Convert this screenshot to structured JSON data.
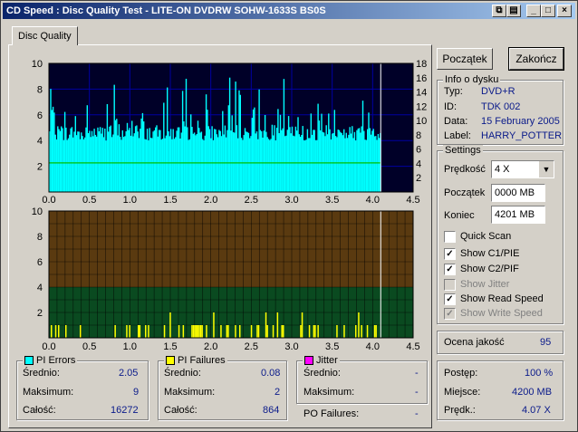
{
  "window": {
    "title": "CD Speed : Disc Quality Test - LITE-ON DVDRW SOHW-1633S BS0S",
    "min_glyph": "_",
    "max_glyph": "□",
    "close_glyph": "×"
  },
  "tabs": [
    {
      "label": "Disc Quality"
    }
  ],
  "buttons": {
    "start": "Początek",
    "end": "Zakończ"
  },
  "disc_info": {
    "title": "Info o dysku",
    "rows": [
      {
        "label": "Typ:",
        "value": "DVD+R"
      },
      {
        "label": "ID:",
        "value": "TDK 002"
      },
      {
        "label": "Data:",
        "value": "15 February 2005"
      },
      {
        "label": "Label:",
        "value": "HARRY_POTTER"
      }
    ]
  },
  "settings": {
    "title": "Settings",
    "speed_label": "Prędkość",
    "speed_value": "4 X",
    "start_label": "Początek",
    "start_value": "0000 MB",
    "end_label": "Koniec",
    "end_value": "4201 MB",
    "checkboxes": [
      {
        "label": "Quick Scan",
        "checked": false,
        "enabled": true
      },
      {
        "label": "Show C1/PIE",
        "checked": true,
        "enabled": true
      },
      {
        "label": "Show C2/PIF",
        "checked": true,
        "enabled": true
      },
      {
        "label": "Show Jitter",
        "checked": false,
        "enabled": false
      },
      {
        "label": "Show Read Speed",
        "checked": true,
        "enabled": true
      },
      {
        "label": "Show Write Speed",
        "checked": true,
        "enabled": false
      }
    ]
  },
  "quality": {
    "label": "Ocena jakość",
    "value": "95"
  },
  "progress": {
    "rows": [
      {
        "label": "Postęp:",
        "value": "100 %"
      },
      {
        "label": "Miejsce:",
        "value": "4200 MB"
      },
      {
        "label": "Prędk.:",
        "value": "4.07 X"
      }
    ]
  },
  "stats": {
    "pi_errors": {
      "title": "PI Errors",
      "color": "#00ffff",
      "rows": [
        {
          "label": "Średnio:",
          "value": "2.05"
        },
        {
          "label": "Maksimum:",
          "value": "9"
        },
        {
          "label": "Całość:",
          "value": "16272"
        }
      ]
    },
    "pi_failures": {
      "title": "PI Failures",
      "color": "#ffff00",
      "rows": [
        {
          "label": "Średnio:",
          "value": "0.08"
        },
        {
          "label": "Maksimum:",
          "value": "2"
        },
        {
          "label": "Całość:",
          "value": "864"
        }
      ]
    },
    "jitter": {
      "title": "Jitter",
      "color": "#ff00ff",
      "rows": [
        {
          "label": "Średnio:",
          "value": "-"
        },
        {
          "label": "Maksimum:",
          "value": "-"
        }
      ]
    },
    "po_failures": {
      "label": "PO Failures:",
      "value": "-"
    }
  },
  "colors": {
    "chart_bg_top": "#000028",
    "grid": "#0000a0",
    "pie": "#00ffff",
    "read_speed": "#00c000",
    "pif": "#ffff00",
    "pif_bg_top": "#5a3a10",
    "pif_bg_bottom": "#0a4a20"
  },
  "chart_data": [
    {
      "type": "bar",
      "name": "PI Errors",
      "xlim": [
        0,
        4.5
      ],
      "ylim": [
        0,
        10
      ],
      "y2lim": [
        0,
        18
      ],
      "x_ticks": [
        "0.0",
        "0.5",
        "1.0",
        "1.5",
        "2.0",
        "2.5",
        "3.0",
        "3.5",
        "4.0",
        "4.5"
      ],
      "y_ticks": [
        "2",
        "4",
        "6",
        "8",
        "10"
      ],
      "y2_ticks": [
        "2",
        "4",
        "6",
        "8",
        "10",
        "12",
        "14",
        "16",
        "18"
      ],
      "data_end_x": 4.1,
      "pie_base": 4.0,
      "read_speed": 4.07
    },
    {
      "type": "bar",
      "name": "PI Failures",
      "xlim": [
        0,
        4.5
      ],
      "ylim": [
        0,
        10
      ],
      "x_ticks": [
        "0.0",
        "0.5",
        "1.0",
        "1.5",
        "2.0",
        "2.5",
        "3.0",
        "3.5",
        "4.0",
        "4.5"
      ],
      "y_ticks": [
        "2",
        "4",
        "6",
        "8",
        "10"
      ],
      "pif_max": 2
    }
  ]
}
